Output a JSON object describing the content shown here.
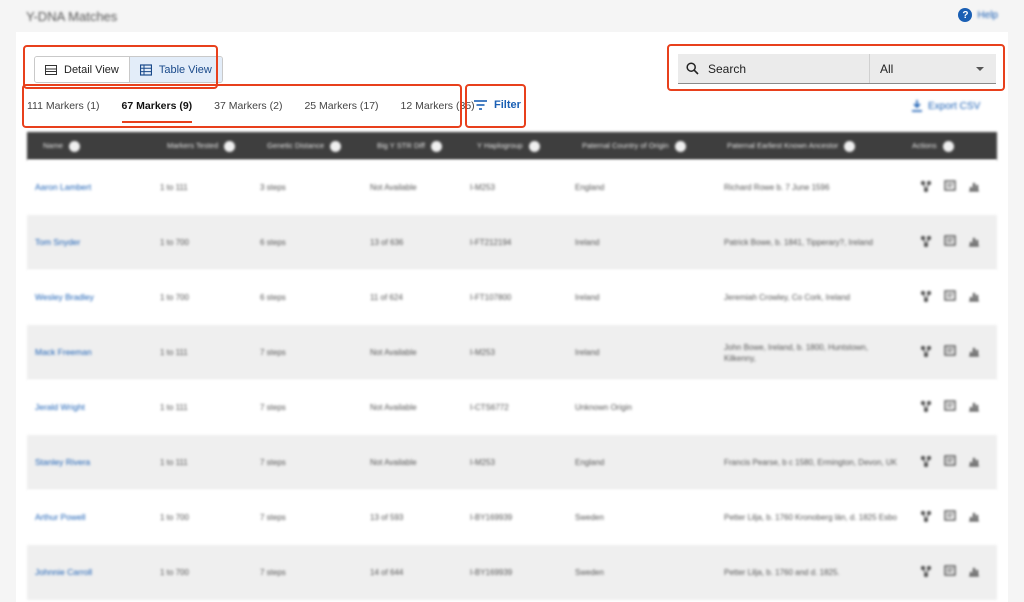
{
  "app": {
    "title": "Y-DNA Matches",
    "help_label": "Help"
  },
  "view_toggle": {
    "detail_label": "Detail View",
    "table_label": "Table View",
    "active": "table"
  },
  "search": {
    "label": "Search",
    "scope_value": "All"
  },
  "marker_tabs": [
    {
      "label": "111 Markers (1)"
    },
    {
      "label": "67 Markers (9)"
    },
    {
      "label": "37 Markers (2)"
    },
    {
      "label": "25 Markers (17)"
    },
    {
      "label": "12 Markers (35)"
    }
  ],
  "active_tab": "67 Markers (9)",
  "filter": {
    "label": "Filter"
  },
  "export": {
    "label": "Export CSV"
  },
  "table": {
    "headers": {
      "name": "Name",
      "markers_tested": "Markers Tested",
      "genetic_distance": "Genetic Distance",
      "big_y": "Big Y STR Diff",
      "haplogroup": "Y Haplogroup",
      "country": "Paternal Country of Origin",
      "ancestor": "Paternal Earliest Known Ancestor",
      "actions": "Actions"
    },
    "rows": [
      {
        "name": "Aaron Lambert",
        "markers": "1 to 111",
        "distance": "3 steps",
        "bigy": "Not Available",
        "haplo": "I-M253",
        "country": "England",
        "ancestor": "Richard Rowe b. 7 June 1596"
      },
      {
        "name": "Tom Snyder",
        "markers": "1 to 700",
        "distance": "6 steps",
        "bigy": "13 of 636",
        "haplo": "I-FT212194",
        "country": "Ireland",
        "ancestor": "Patrick Bowe, b. 1841, Tipperary?, Ireland"
      },
      {
        "name": "Wesley Bradley",
        "markers": "1 to 700",
        "distance": "6 steps",
        "bigy": "11 of 624",
        "haplo": "I-FT107800",
        "country": "Ireland",
        "ancestor": "Jeremiah Crowley, Co Cork, Ireland"
      },
      {
        "name": "Mack Freeman",
        "markers": "1 to 111",
        "distance": "7 steps",
        "bigy": "Not Available",
        "haplo": "I-M253",
        "country": "Ireland",
        "ancestor": "John Bowe, Ireland, b. 1800, Huntstown, Kilkenny,"
      },
      {
        "name": "Jerald Wright",
        "markers": "1 to 111",
        "distance": "7 steps",
        "bigy": "Not Available",
        "haplo": "I-CTS6772",
        "country": "Unknown Origin",
        "ancestor": ""
      },
      {
        "name": "Stanley Rivera",
        "markers": "1 to 111",
        "distance": "7 steps",
        "bigy": "Not Available",
        "haplo": "I-M253",
        "country": "England",
        "ancestor": "Francis Pearse, b c 1580, Ermington, Devon, UK"
      },
      {
        "name": "Arthur Powell",
        "markers": "1 to 700",
        "distance": "7 steps",
        "bigy": "13 of 593",
        "haplo": "I-BY169939",
        "country": "Sweden",
        "ancestor": "Petter Lilja, b. 1760 Kronoberg län, d. 1825 Esbo"
      },
      {
        "name": "Johnnie Carroll",
        "markers": "1 to 700",
        "distance": "7 steps",
        "bigy": "14 of 644",
        "haplo": "I-BY169939",
        "country": "Sweden",
        "ancestor": "Petter Lilja, b. 1760 and d. 1825."
      }
    ]
  },
  "colors": {
    "accent": "#1a5fb4",
    "highlight": "#e8401c",
    "header_bg": "#3e3e3e"
  }
}
